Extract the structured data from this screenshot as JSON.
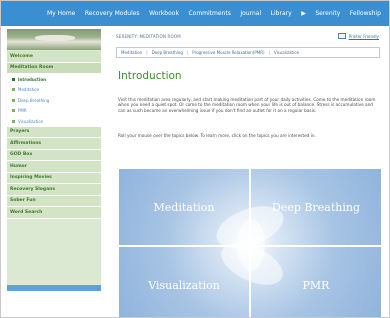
{
  "topnav": {
    "items": [
      "My Home",
      "Recovery Modules",
      "Workbook",
      "Commitments",
      "Journal",
      "Library",
      "Serenity",
      "Fellowship"
    ]
  },
  "sidebar": {
    "items": [
      {
        "label": "Welcome"
      },
      {
        "label": "Meditation Room"
      },
      {
        "label": "Introduction"
      },
      {
        "label": "Meditation"
      },
      {
        "label": "Deep Breathing"
      },
      {
        "label": "PMR"
      },
      {
        "label": "Visualization"
      },
      {
        "label": "Prayers"
      },
      {
        "label": "Affirmations"
      },
      {
        "label": "GOD Box"
      },
      {
        "label": "Humor"
      },
      {
        "label": "Inspiring Movies"
      },
      {
        "label": "Recovery Slogans"
      },
      {
        "label": "Sober Fun"
      },
      {
        "label": "Word Search"
      }
    ]
  },
  "breadcrumb": "SERENITY: MEDITATION ROOM",
  "printer_friendly": "Printer Friendly",
  "tabs": [
    "Meditation",
    "Deep Breathing",
    "Progressive Muscle Relaxation(PMR)",
    "Visualization"
  ],
  "title": "Introduction",
  "paragraph1": "Visit this meditation area regularly, and start making meditation part of your daily activities. Come to the meditation room when you need a quiet spot. Or come to the meditation room when your life is out of balance. Stress is accumulative and can as such become an overwhelming issue if you don't find an outlet for it on a regular basis.",
  "paragraph2": "Roll your mouse over the topics below. To learn more, click on the topics you are interested in.",
  "quadrants": [
    "Meditation",
    "Deep Breathing",
    "Visualization",
    "PMR"
  ]
}
